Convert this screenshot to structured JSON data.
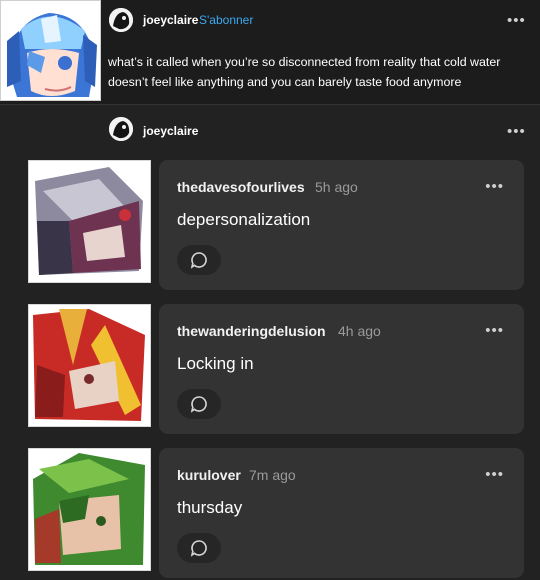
{
  "post": {
    "username": "joeyclaire",
    "follow_label": "S'abonner",
    "more_icon": "•••",
    "text": "what’s it called when you’re so disconnected from reality that cold water doesn’t feel like anything and you can barely taste food anymore"
  },
  "reblog": {
    "username": "joeyclaire",
    "more_icon": "•••"
  },
  "replies": [
    {
      "username": "thedavesofourlives",
      "time": "5h ago",
      "text": "depersonalization",
      "more_icon": "•••",
      "avatar_color": "#8a3a5a"
    },
    {
      "username": "thewanderingdelusion",
      "time": "4h ago",
      "text": "Locking in",
      "more_icon": "•••",
      "avatar_color": "#c8302a"
    },
    {
      "username": "kurulover",
      "time": "7m ago",
      "text": "thursday",
      "more_icon": "•••",
      "avatar_color": "#3f8a2e"
    }
  ],
  "colors": {
    "accent": "#3ba9f0",
    "card": "#333333",
    "background": "#222222"
  }
}
